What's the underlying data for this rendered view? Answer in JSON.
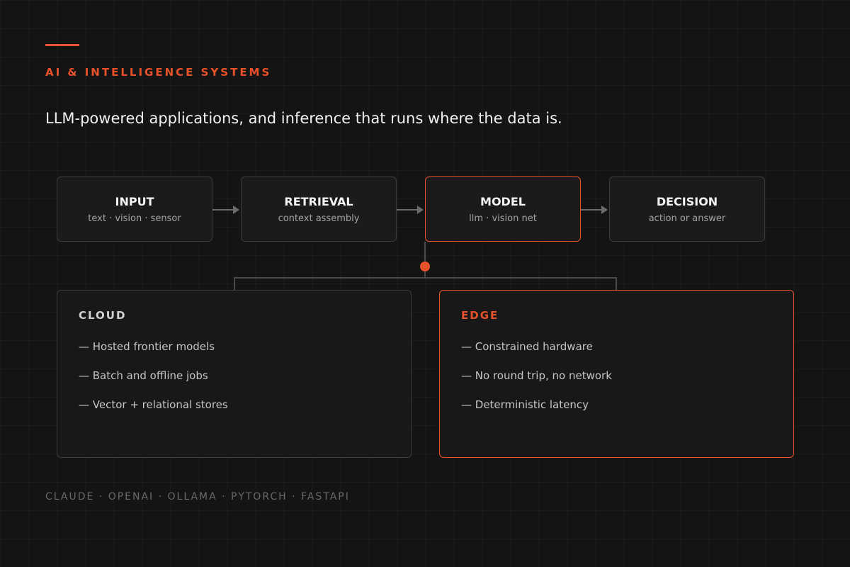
{
  "header": {
    "eyebrow": "AI & INTELLIGENCE SYSTEMS",
    "headline": "LLM-powered applications, and inference that runs where the data is."
  },
  "pipeline": [
    {
      "title": "INPUT",
      "subtitle": "text · vision · sensor"
    },
    {
      "title": "RETRIEVAL",
      "subtitle": "context assembly"
    },
    {
      "title": "MODEL",
      "subtitle": "llm · vision net"
    },
    {
      "title": "DECISION",
      "subtitle": "action or answer"
    }
  ],
  "deployments": [
    {
      "title": "CLOUD",
      "items": [
        "— Hosted frontier models",
        "— Batch and offline jobs",
        "— Vector + relational stores"
      ]
    },
    {
      "title": "EDGE",
      "items": [
        "— Constrained hardware",
        "— No round trip, no network",
        "— Deterministic latency"
      ]
    }
  ],
  "footer": "CLAUDE · OPENAI · OLLAMA · PYTORCH · FASTAPI",
  "colors": {
    "accent": "#e8512a",
    "background": "#141414",
    "border": "#3b3b3b"
  }
}
